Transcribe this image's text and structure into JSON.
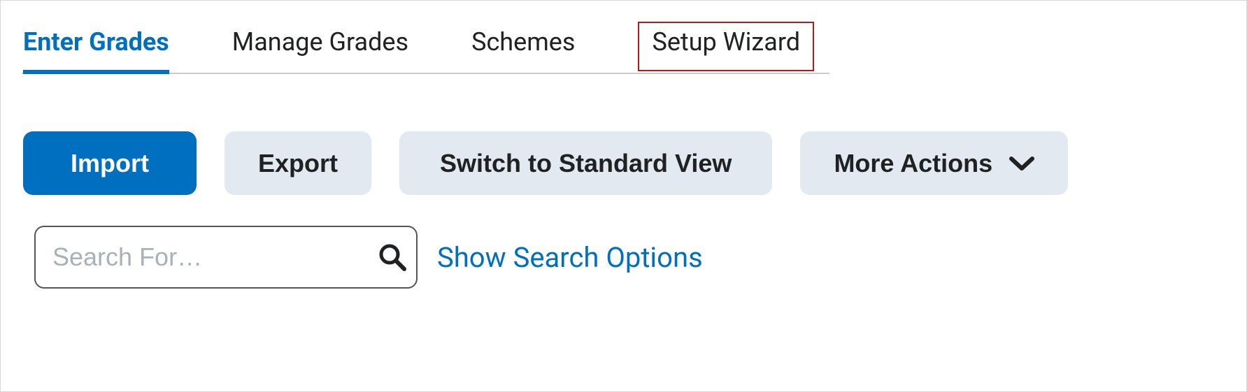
{
  "tabs": {
    "enter_grades": "Enter Grades",
    "manage_grades": "Manage Grades",
    "schemes": "Schemes",
    "setup_wizard": "Setup Wizard"
  },
  "actions": {
    "import": "Import",
    "export": "Export",
    "switch_view": "Switch to Standard View",
    "more_actions": "More Actions"
  },
  "search": {
    "placeholder": "Search For…",
    "show_options": "Show Search Options"
  }
}
